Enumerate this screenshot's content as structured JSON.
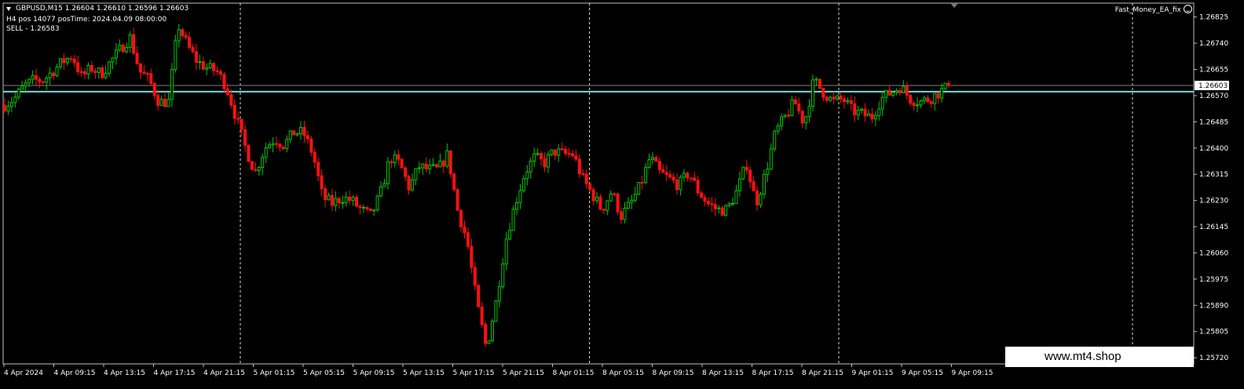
{
  "header": {
    "symbol_line": "GBPUSD,M15  1.26604 1.26610 1.26596 1.26603",
    "info_line": "H4 pos 14077 posTime: 2024.04.09 08:00:00",
    "signal_line": "SELL - 1.26583",
    "ea_label": "Fast_Money_EA_fix"
  },
  "watermark": "www.mt4.shop",
  "colors": {
    "bull": "#00c800",
    "bear": "#ff1010",
    "bid_line": "#808080",
    "signal_line": "#66e0e0",
    "grid": "#ffffff",
    "axis_text": "#ffffff"
  },
  "chart_data": {
    "type": "candlestick",
    "symbol": "GBPUSD",
    "timeframe": "M15",
    "last_ohlc": {
      "open": 1.26604,
      "high": 1.2661,
      "low": 1.26596,
      "close": 1.26603
    },
    "current_price_label": "1.26603",
    "bid_line_price": 1.26603,
    "signal_line_price": 1.26583,
    "ylim": [
      1.257,
      1.2687
    ],
    "yticks": [
      "1.26825",
      "1.26740",
      "1.26655",
      "1.26570",
      "1.26485",
      "1.26400",
      "1.26315",
      "1.26230",
      "1.26145",
      "1.26060",
      "1.25975",
      "1.25890",
      "1.25805",
      "1.25720"
    ],
    "xticks": [
      "4 Apr 2024",
      "4 Apr 09:15",
      "4 Apr 13:15",
      "4 Apr 17:15",
      "4 Apr 21:15",
      "5 Apr 01:15",
      "5 Apr 05:15",
      "5 Apr 09:15",
      "5 Apr 13:15",
      "5 Apr 17:15",
      "5 Apr 21:15",
      "8 Apr 01:15",
      "8 Apr 05:15",
      "8 Apr 09:15",
      "8 Apr 13:15",
      "8 Apr 17:15",
      "8 Apr 21:15",
      "9 Apr 01:15",
      "9 Apr 05:15",
      "9 Apr 09:15"
    ],
    "session_separators": [
      "4 Apr 21:15",
      "8 Apr 01:15",
      "8 Apr 21:15"
    ],
    "trend_points": [
      [
        1.2654,
        1.2656,
        1.266,
        1.2662,
        1.2662,
        1.2665,
        1.2668,
        1.267,
        1.2663,
        1.2666,
        1.2664,
        1.2668,
        1.2672,
        1.2676,
        1.2665,
        1.2662,
        1.2655
      ],
      [
        1.2655,
        1.268,
        1.2673,
        1.2668,
        1.2666,
        1.2665,
        1.266,
        1.265,
        1.264,
        1.2632,
        1.264,
        1.2643,
        1.2641,
        1.2645
      ],
      [
        1.2645,
        1.2638,
        1.2624,
        1.2622,
        1.2624,
        1.2623,
        1.262,
        1.2618,
        1.2625,
        1.2637,
        1.2635,
        1.2627,
        1.2634,
        1.2633
      ],
      [
        1.2633,
        1.2638,
        1.262,
        1.261,
        1.259,
        1.2575,
        1.259,
        1.261,
        1.2622,
        1.2632,
        1.2637,
        1.2635,
        1.2639,
        1.2638
      ],
      [
        1.2638,
        1.263,
        1.2625,
        1.262,
        1.2626,
        1.2618,
        1.2622,
        1.2628,
        1.2637,
        1.2632,
        1.263,
        1.2628,
        1.2632,
        1.2626,
        1.2622,
        1.262
      ],
      [
        1.262,
        1.2626,
        1.2635,
        1.2622,
        1.2632,
        1.2645,
        1.265,
        1.2655,
        1.2648,
        1.2662,
        1.2658,
        1.2655,
        1.2656,
        1.2652,
        1.2651,
        1.265,
        1.2656,
        1.2658,
        1.266,
        1.2656,
        1.2655,
        1.2656,
        1.2658,
        1.266
      ]
    ]
  }
}
